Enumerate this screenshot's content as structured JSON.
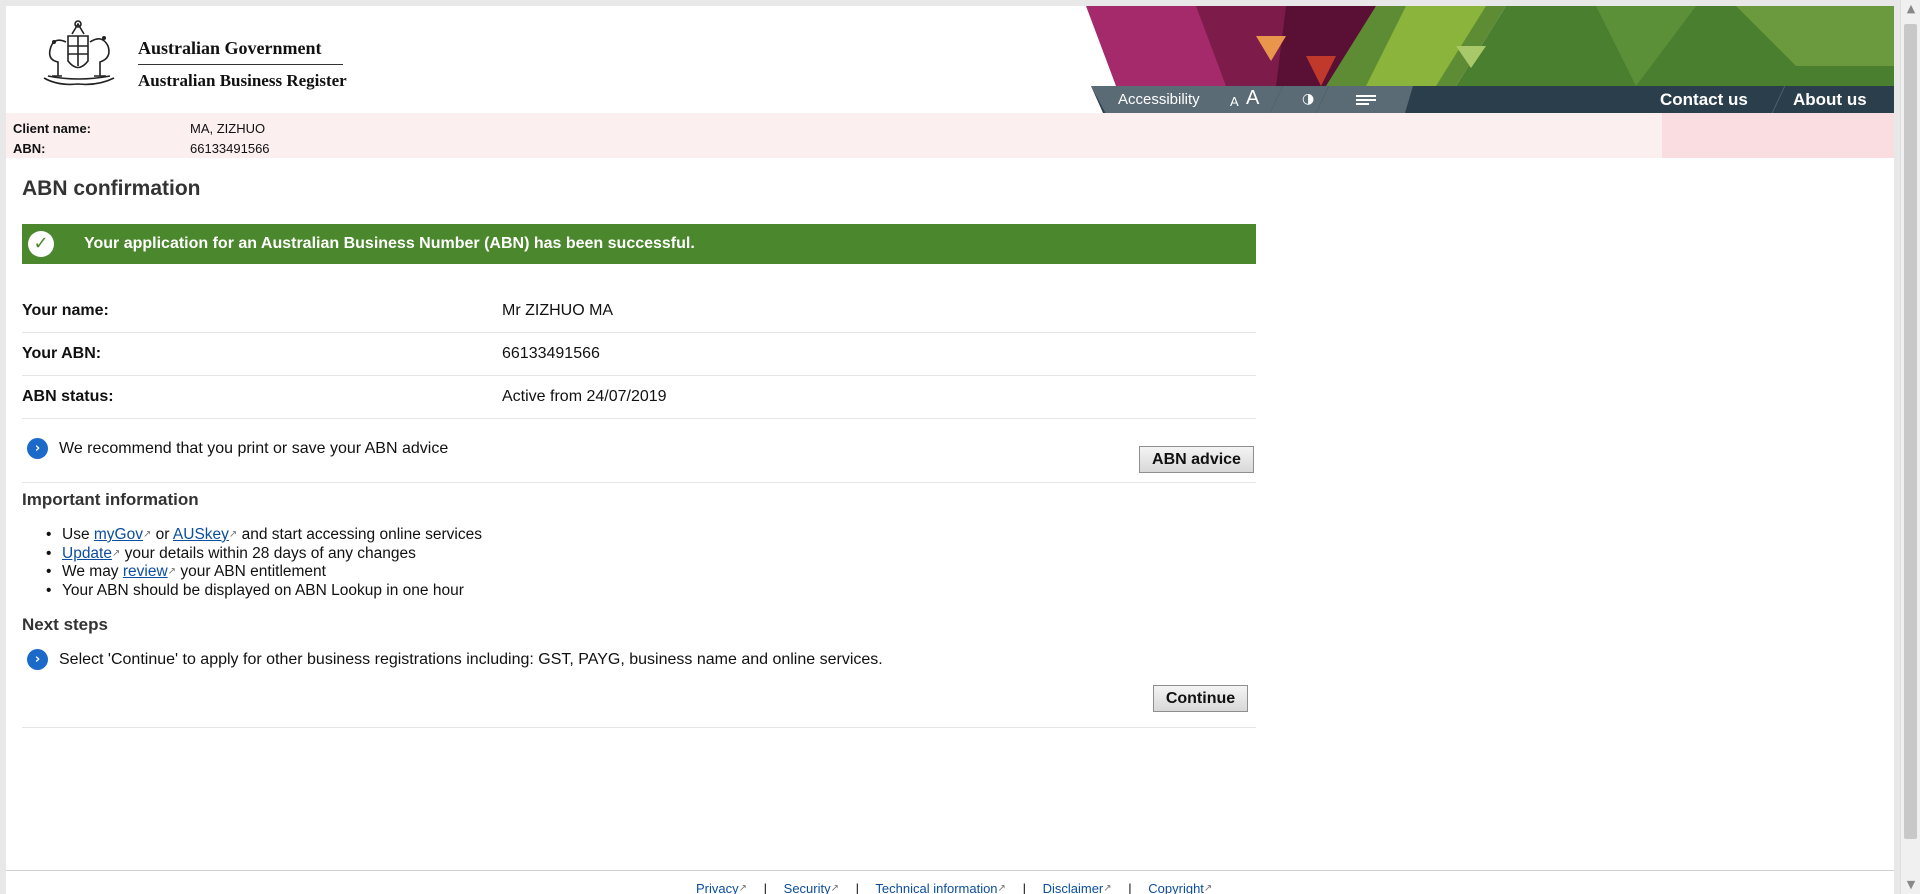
{
  "header": {
    "org_line1": "Australian Government",
    "org_line2": "Australian Business Register",
    "accessibility": "Accessibility",
    "font_small": "A",
    "font_large": "A",
    "contact_us": "Contact us",
    "about_us": "About us"
  },
  "client": {
    "name_label": "Client name:",
    "name_value": "MA, ZIZHUO",
    "abn_label": "ABN:",
    "abn_value": "66133491566"
  },
  "main": {
    "title": "ABN confirmation",
    "success_message": "Your application for an Australian Business Number (ABN) has been successful.",
    "details": [
      {
        "label": "Your name:",
        "value": "Mr ZIZHUO MA"
      },
      {
        "label": "Your ABN:",
        "value": "66133491566"
      },
      {
        "label": "ABN status:",
        "value": "Active from 24/07/2019"
      }
    ],
    "recommend_text": "We recommend that you print or save your ABN advice",
    "abn_advice_button": "ABN advice",
    "important_title": "Important information",
    "bullets": {
      "b1_pre": "Use ",
      "b1_link1": "myGov",
      "b1_mid": " or ",
      "b1_link2": "AUSkey",
      "b1_post": " and start accessing online services",
      "b2_link": "Update",
      "b2_post": " your details within 28 days of any changes",
      "b3_pre": "We may ",
      "b3_link": "review",
      "b3_post": " your ABN entitlement",
      "b4": "Your ABN should be displayed on ABN Lookup in one hour"
    },
    "next_steps_title": "Next steps",
    "next_steps_text": "Select 'Continue' to apply for other business registrations including: GST, PAYG, business name and online services.",
    "continue_button": "Continue"
  },
  "footer": {
    "links": [
      "Privacy",
      "Security",
      "Technical information",
      "Disclaimer",
      "Copyright"
    ],
    "separator": "|"
  },
  "colors": {
    "success_green": "#4b872c",
    "nav_dark": "#2b3e4c",
    "link_blue": "#0b4d9e",
    "client_bar_pink": "#fbeff0",
    "arrow_blue": "#1b6ac9"
  },
  "icons": {
    "success": "check-circle-icon",
    "info": "chevron-right-circle-icon",
    "external": "external-link-icon",
    "contrast": "contrast-icon",
    "menu": "menu-icon"
  }
}
